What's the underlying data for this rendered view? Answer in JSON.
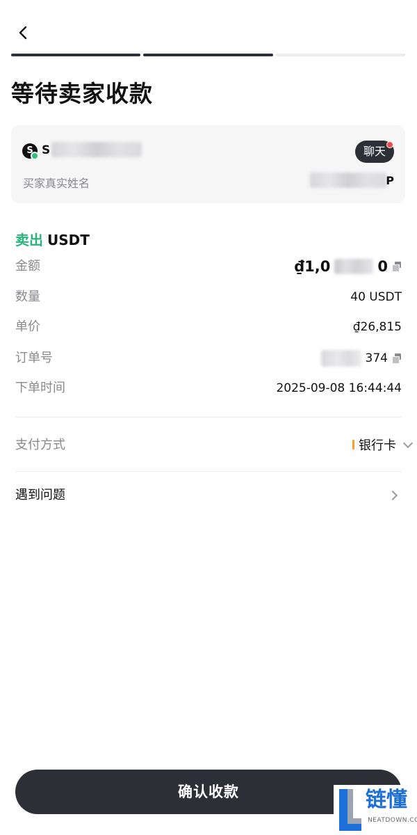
{
  "header": {
    "title": "等待卖家收款",
    "progress": {
      "total_steps": 3,
      "completed_steps": 2
    }
  },
  "buyer": {
    "avatar_letter": "S",
    "name_visible": "S",
    "chat_label": "聊天",
    "realname_label": "买家真实姓名",
    "realname_tail": "P"
  },
  "order": {
    "side": "卖出",
    "asset": "USDT",
    "rows": {
      "amount": {
        "label": "金额",
        "prefix": "₫1,0",
        "suffix": "0"
      },
      "quantity": {
        "label": "数量",
        "value": "40 USDT"
      },
      "price": {
        "label": "单价",
        "value": "₫26,815"
      },
      "order_no": {
        "label": "订单号",
        "suffix": "374"
      },
      "time": {
        "label": "下单时间",
        "value": "2025-09-08 16:44:44"
      }
    }
  },
  "payment": {
    "label": "支付方式",
    "value": "银行卡"
  },
  "problem": {
    "label": "遇到问题"
  },
  "footer": {
    "confirm_label": "确认收款"
  },
  "watermark": {
    "text": "链懂",
    "sub": "NEATDOWN.COM"
  },
  "colors": {
    "accent_green": "#27b47a",
    "dark": "#2c2f36",
    "bank_marker": "#f0a22b",
    "notification": "#f24a4a",
    "watermark_blue": "#1b6fd6"
  }
}
